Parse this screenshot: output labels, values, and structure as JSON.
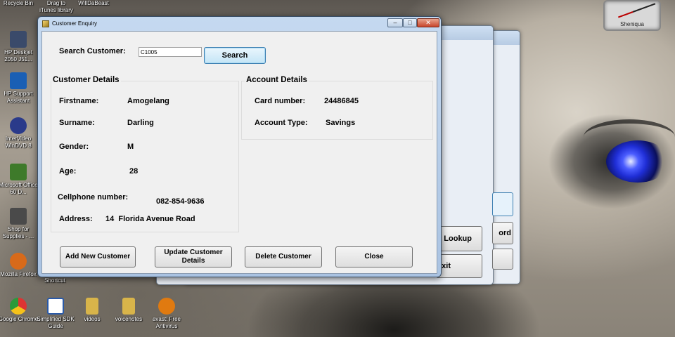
{
  "desktop": {
    "top_labels": [
      "Recycle Bin",
      "Drag to iTunes library",
      "WillDaBeast"
    ],
    "icons": [
      {
        "label": "HP Deskjet 2050 J51...",
        "icon": "printer-icon",
        "color": "#3a4a6a"
      },
      {
        "label": "HP Support Assistant",
        "icon": "hp-support-icon",
        "color": "#1a5fb4"
      },
      {
        "label": "InterVideo WinDVD 8",
        "icon": "dvd-icon",
        "color": "#2a3a8a"
      },
      {
        "label": "Microsoft Office 60 D...",
        "icon": "office-icon",
        "color": "#3e7a2a"
      },
      {
        "label": "Shop for Supplies - ...",
        "icon": "shop-icon",
        "color": "#4a4a4a"
      },
      {
        "label": "Mozilla Firefox",
        "icon": "firefox-icon",
        "color": "#d86a1a"
      },
      {
        "label": "Google Chrome",
        "icon": "chrome-icon",
        "color": "#3a8a3a"
      }
    ],
    "bottom_icons": [
      {
        "label": "Simplified SDK Guide",
        "icon": "word-document-icon",
        "color": "#2a5aa8"
      },
      {
        "label": "videos",
        "icon": "folder-icon",
        "color": "#d8b44a"
      },
      {
        "label": "voicenotes",
        "icon": "folder-icon",
        "color": "#d8b44a"
      },
      {
        "label": "avast! Free Antivirus",
        "icon": "avast-icon",
        "color": "#e07a10"
      }
    ],
    "shortcut_label": "Shortcut",
    "clock_name": "Sheniqua"
  },
  "background_window": {
    "buttons": [
      "Lookup",
      "ord",
      "xit"
    ]
  },
  "window": {
    "title": "Customer Enquiry",
    "controls": {
      "minimize": "–",
      "maximize": "□",
      "close": "✕"
    }
  },
  "search": {
    "label": "Search Customer:",
    "value": "C1005",
    "button": "Search"
  },
  "customer_details": {
    "title": "Customer Details",
    "firstname_label": "Firstname:",
    "firstname": "Amogelang",
    "surname_label": "Surname:",
    "surname": "Darling",
    "gender_label": "Gender:",
    "gender": "M",
    "age_label": "Age:",
    "age": "28",
    "cell_label": "Cellphone number:",
    "cell": "082-854-9636",
    "address_label": "Address:",
    "address": "14  Florida Avenue Road"
  },
  "account_details": {
    "title": "Account Details",
    "card_label": "Card number:",
    "card": "24486845",
    "type_label": "Account Type:",
    "type": "Savings"
  },
  "actions": {
    "add": "Add New Customer",
    "update": "Update Customer Details",
    "delete": "Delete Customer",
    "close": "Close"
  }
}
